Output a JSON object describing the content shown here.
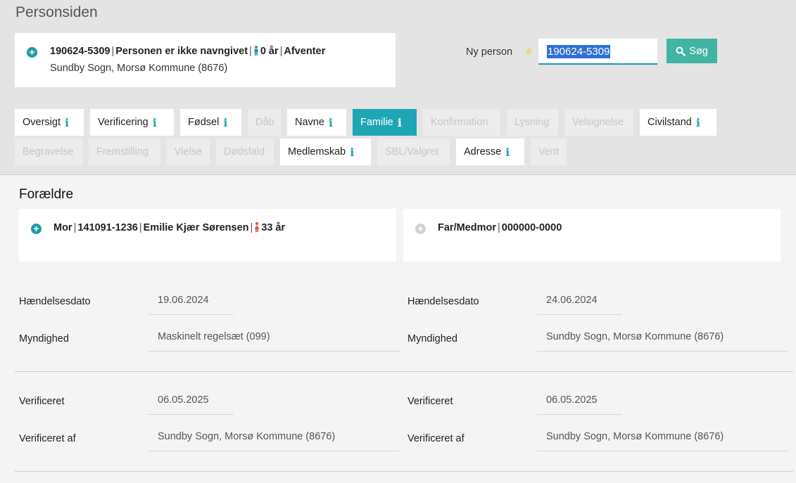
{
  "page": {
    "title": "Personsiden"
  },
  "person": {
    "cpr": "190624-5309",
    "name": "Personen er ikke navngivet",
    "age": "0 år",
    "status": "Afventer",
    "location": "Sundby Sogn, Morsø Kommune (8676)"
  },
  "search": {
    "label": "Ny person",
    "value": "190624-5309",
    "button_label": "Søg"
  },
  "tabs": [
    {
      "label": "Oversigt",
      "state": "enabled"
    },
    {
      "label": "Verificering",
      "state": "enabled"
    },
    {
      "label": "Fødsel",
      "state": "enabled"
    },
    {
      "label": "Dåb",
      "state": "disabled"
    },
    {
      "label": "Navne",
      "state": "enabled"
    },
    {
      "label": "Familie",
      "state": "active"
    },
    {
      "label": "Konfirmation",
      "state": "disabled"
    },
    {
      "label": "Lysning",
      "state": "disabled"
    },
    {
      "label": "Velsignelse",
      "state": "disabled"
    },
    {
      "label": "Civilstand",
      "state": "enabled"
    },
    {
      "label": "Begravelse",
      "state": "disabled"
    },
    {
      "label": "Fremstilling",
      "state": "disabled"
    },
    {
      "label": "Vielse",
      "state": "disabled"
    },
    {
      "label": "Dødsfald",
      "state": "disabled"
    },
    {
      "label": "Medlemskab",
      "state": "enabled"
    },
    {
      "label": "SBL/Valgret",
      "state": "disabled"
    },
    {
      "label": "Adresse",
      "state": "enabled"
    },
    {
      "label": "Vent",
      "state": "disabled"
    }
  ],
  "info_glyph": "i",
  "section": {
    "title": "Forældre"
  },
  "mother": {
    "role": "Mor",
    "cpr": "141091-1236",
    "name": "Emilie Kjær Sørensen",
    "age": "33 år"
  },
  "father": {
    "role": "Far/Medmor",
    "cpr": "000000-0000"
  },
  "details": {
    "left": {
      "event_label": "Hændelsesdato",
      "event_value": "19.06.2024",
      "authority_label": "Myndighed",
      "authority_value": "Maskinelt regelsæt (099)",
      "verified_label": "Verificeret",
      "verified_value": "06.05.2025",
      "verified_by_label": "Verificeret af",
      "verified_by_value": "Sundby Sogn, Morsø Kommune (8676)"
    },
    "right": {
      "event_label": "Hændelsesdato",
      "event_value": "24.06.2024",
      "authority_label": "Myndighed",
      "authority_value": "Sundby Sogn, Morsø Kommune (8676)",
      "verified_label": "Verificeret",
      "verified_value": "06.05.2025",
      "verified_by_label": "Verificeret af",
      "verified_by_value": "Sundby Sogn, Morsø Kommune (8676)"
    }
  },
  "colors": {
    "accent": "#1fa6b4",
    "button": "#41b4a3",
    "male_icon": "#1f9ba5",
    "female_icon": "#d9542b"
  },
  "icons": {
    "expand": "plus-circle-icon",
    "male": "male-person-icon",
    "female": "female-person-icon",
    "search": "magnifier-icon",
    "info": "info-icon"
  }
}
